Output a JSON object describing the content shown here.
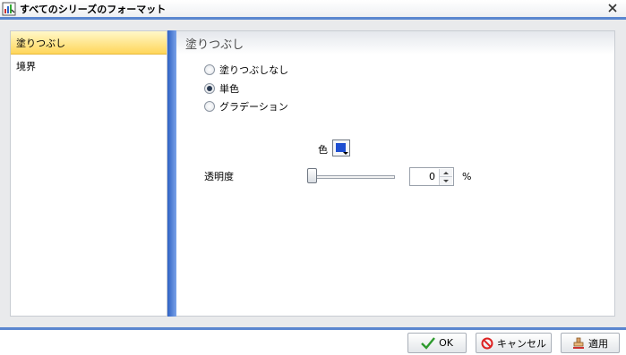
{
  "window": {
    "title": "すべてのシリーズのフォーマット"
  },
  "sidebar": {
    "items": [
      {
        "label": "塗りつぶし",
        "selected": true
      },
      {
        "label": "境界",
        "selected": false
      }
    ]
  },
  "panel": {
    "header": "塗りつぶし",
    "fill_options": [
      {
        "label": "塗りつぶしなし",
        "checked": false
      },
      {
        "label": "単色",
        "checked": true
      },
      {
        "label": "グラデーション",
        "checked": false
      }
    ],
    "color_label": "色",
    "color_value": "#1f4fd1",
    "transparency_label": "透明度",
    "transparency_value": "0",
    "transparency_unit": "%"
  },
  "footer": {
    "ok_label": "OK",
    "cancel_label": "キャンセル",
    "apply_label": "適用"
  },
  "colors": {
    "accent": "#5a86cf",
    "selected_item": "#ffd65a"
  }
}
